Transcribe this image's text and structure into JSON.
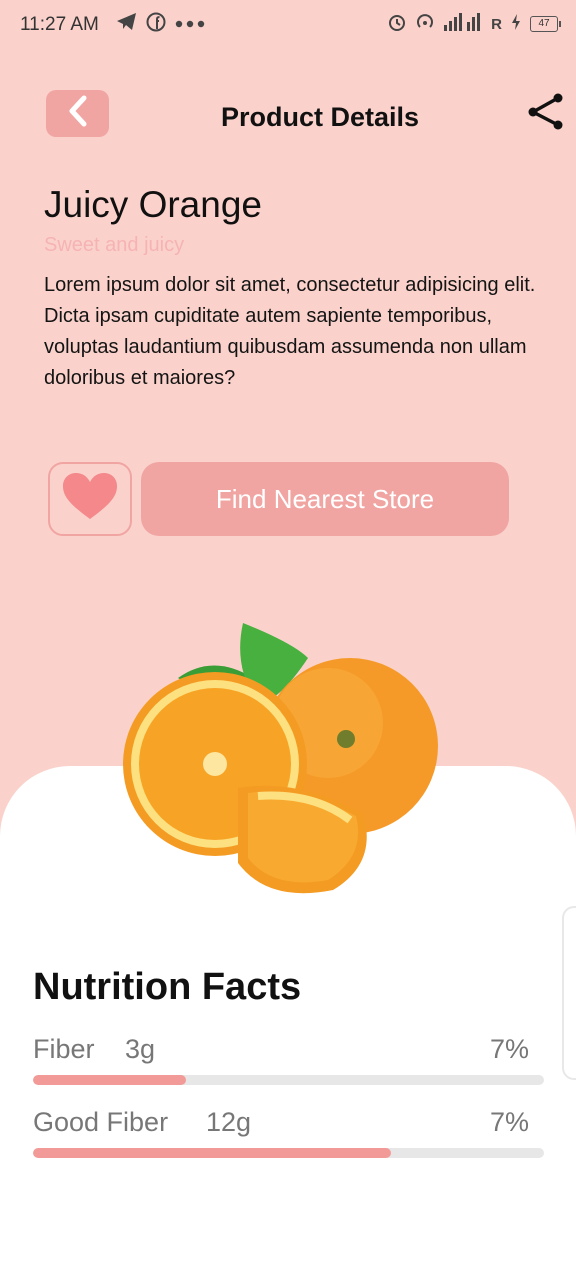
{
  "status_bar": {
    "time": "11:27 AM",
    "battery": "47",
    "network": "R"
  },
  "header": {
    "title": "Product Details"
  },
  "product": {
    "name": "Juicy Orange",
    "tagline": "Sweet and juicy",
    "description": "Lorem ipsum dolor sit amet, consectetur adipisicing elit. Dicta ipsam cupiditate autem sapiente temporibus, voluptas laudantium quibusdam assumenda non ullam doloribus et maiores?"
  },
  "actions": {
    "store_button": "Find Nearest Store"
  },
  "nutrition": {
    "title": "Nutrition Facts",
    "items": [
      {
        "name": "Fiber",
        "amount": "3g",
        "percent": "7%",
        "bar_fill": 0.3
      },
      {
        "name": "Good Fiber",
        "amount": "12g",
        "percent": "7%",
        "bar_fill": 0.7
      }
    ]
  },
  "colors": {
    "background": "#fad2cb",
    "accent": "#f1a5a3",
    "tagline": "#f6b3b4",
    "bar_fill": "#f29a97"
  }
}
